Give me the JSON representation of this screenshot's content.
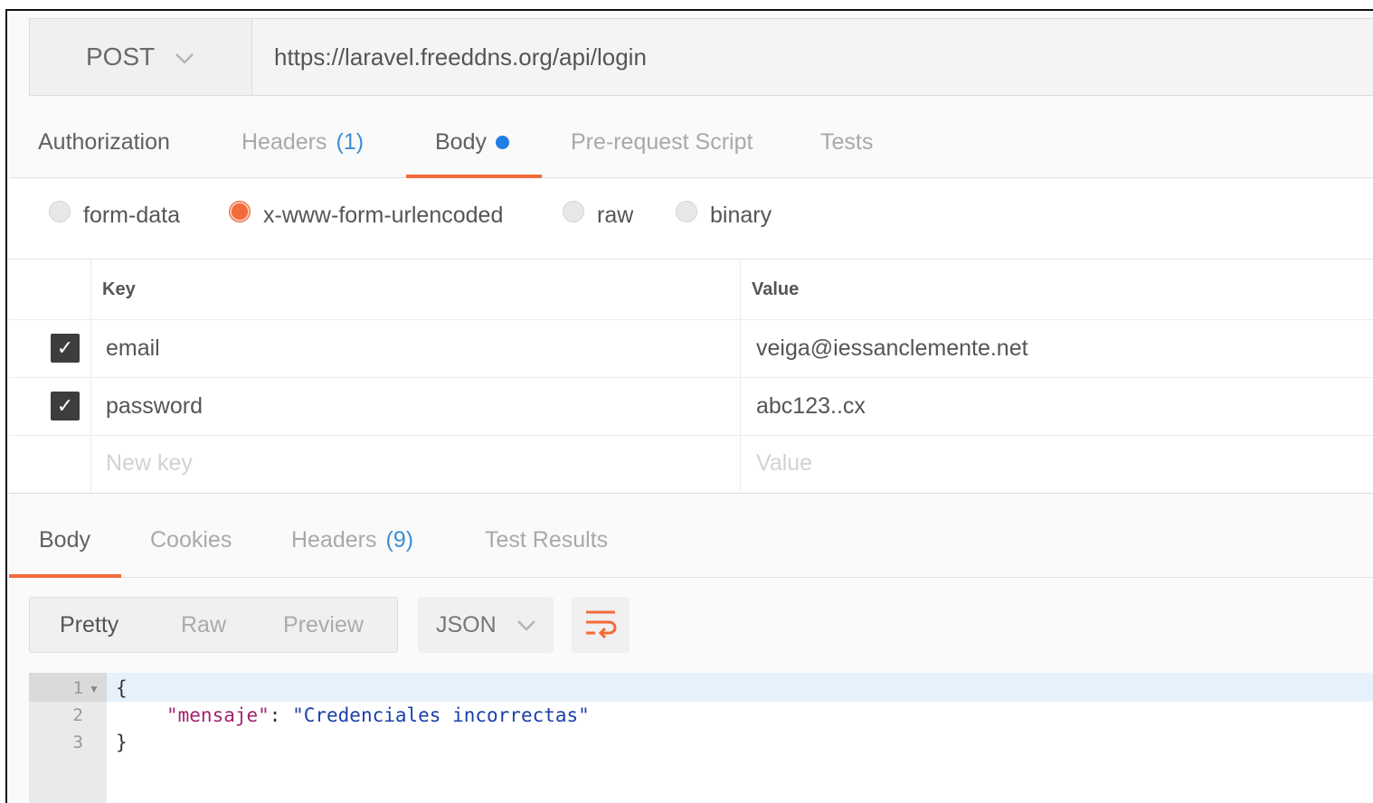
{
  "request": {
    "method": "POST",
    "url": "https://laravel.freeddns.org/api/login",
    "tabs": [
      {
        "label": "Authorization"
      },
      {
        "label": "Headers",
        "count": "(1)"
      },
      {
        "label": "Body"
      },
      {
        "label": "Pre-request Script"
      },
      {
        "label": "Tests"
      }
    ],
    "active_tab": "Body",
    "body_types": [
      "form-data",
      "x-www-form-urlencoded",
      "raw",
      "binary"
    ],
    "selected_body_type": "x-www-form-urlencoded",
    "table": {
      "key_header": "Key",
      "value_header": "Value",
      "rows": [
        {
          "checked": true,
          "key": "email",
          "value": "veiga@iessanclemente.net"
        },
        {
          "checked": true,
          "key": "password",
          "value": "abc123..cx"
        }
      ],
      "new_key_placeholder": "New key",
      "new_value_placeholder": "Value"
    }
  },
  "response": {
    "tabs": [
      {
        "label": "Body"
      },
      {
        "label": "Cookies"
      },
      {
        "label": "Headers",
        "count": "(9)"
      },
      {
        "label": "Test Results"
      }
    ],
    "active_tab": "Body",
    "views": [
      "Pretty",
      "Raw",
      "Preview"
    ],
    "selected_view": "Pretty",
    "format": "JSON",
    "line_numbers": [
      "1",
      "2",
      "3"
    ],
    "code": {
      "open": "{",
      "key": "\"mensaje\"",
      "sep": ": ",
      "value": "\"Credenciales incorrectas\"",
      "close": "}"
    }
  },
  "colors": {
    "accent": "#f26b3a",
    "tab_dot": "#1f7fe5",
    "count": "#3b8ed5"
  },
  "icons": [
    "chevron-down-icon",
    "checkbox-checked-icon",
    "wrap-lines-icon",
    "fold-arrow-icon"
  ]
}
